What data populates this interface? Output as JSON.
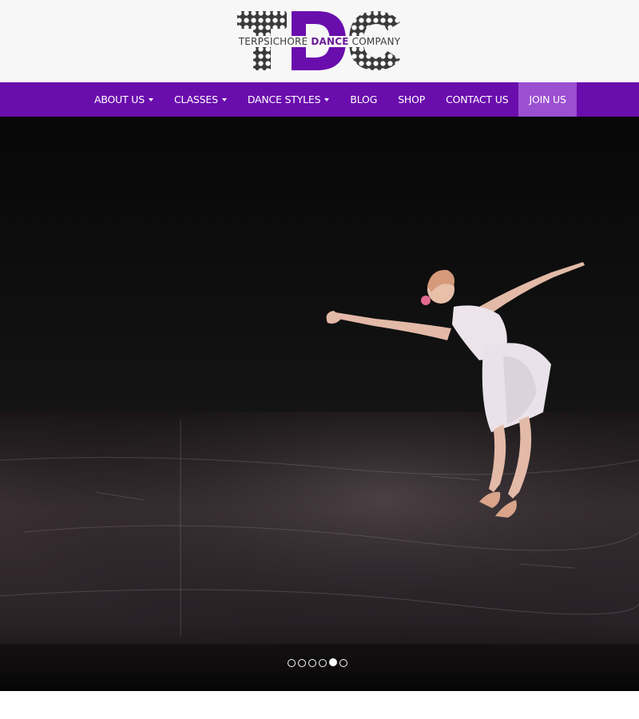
{
  "brand": {
    "logo_letters": "TDC",
    "tagline_before": "TERPSICHORE ",
    "tagline_accent": "DANCE",
    "tagline_after": " COMPANY",
    "primary_color": "#6a0dad",
    "accent_color": "#9b4fd1",
    "logo_gray": "#3b3b3b"
  },
  "nav": {
    "items": [
      {
        "label": "ABOUT US",
        "dropdown": true
      },
      {
        "label": "CLASSES",
        "dropdown": true
      },
      {
        "label": "DANCE STYLES",
        "dropdown": true
      },
      {
        "label": "BLOG",
        "dropdown": false
      },
      {
        "label": "SHOP",
        "dropdown": false
      },
      {
        "label": "CONTACT US",
        "dropdown": false
      },
      {
        "label": "JOIN US",
        "dropdown": false,
        "active": true
      }
    ]
  },
  "slider": {
    "slide_count": 6,
    "active_slide": 5
  }
}
